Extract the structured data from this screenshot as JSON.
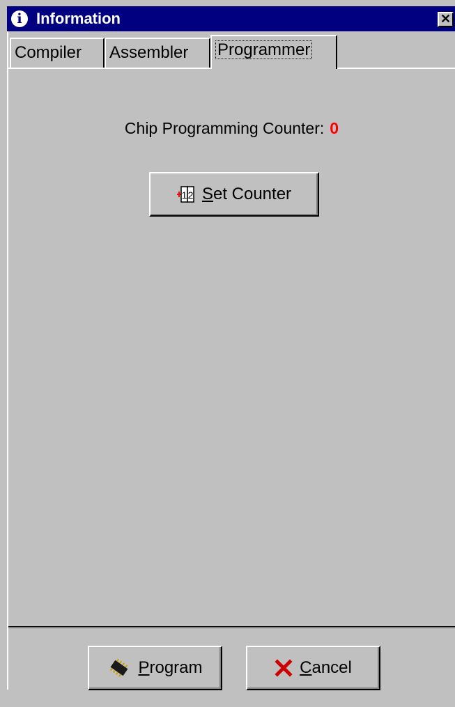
{
  "window": {
    "title": "Information",
    "title_icon": "info-icon",
    "close_glyph": "✕"
  },
  "tabs": [
    {
      "label": "Compiler",
      "active": false
    },
    {
      "label": "Assembler",
      "active": false
    },
    {
      "label": "Programmer",
      "active": true
    }
  ],
  "programmer": {
    "counter_label": "Chip Programming Counter:",
    "counter_value": "0",
    "set_counter_button": {
      "label_hotkey": "S",
      "label_rest": "et Counter",
      "icon": "counter-icon"
    }
  },
  "footer": {
    "program_button": {
      "label_hotkey": "P",
      "label_rest": "rogram",
      "icon": "chip-icon"
    },
    "cancel_button": {
      "label_hotkey": "C",
      "label_rest": "ancel",
      "icon": "cancel-x-icon"
    }
  },
  "colors": {
    "titlebar": "#000080",
    "face": "#c0c0c0",
    "counter_value": "#ff0000",
    "cancel_icon": "#cc0000"
  }
}
